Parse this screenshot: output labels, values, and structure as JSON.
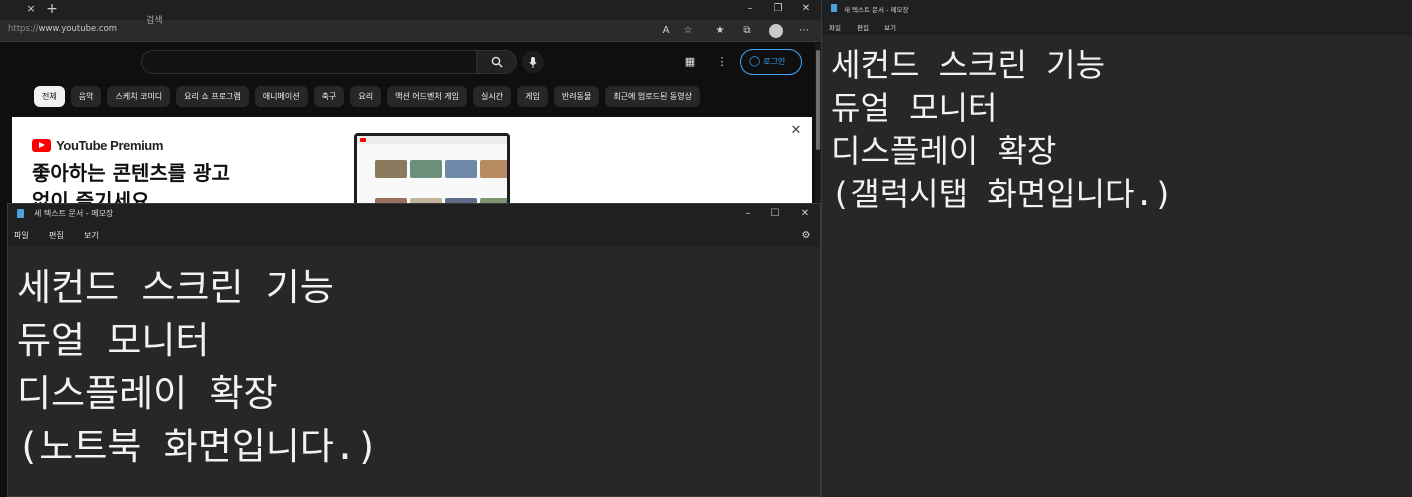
{
  "browser": {
    "url_prefix": "https://",
    "url_host": "www.youtube.com",
    "tab_close_glyph": "×",
    "new_tab_glyph": "+",
    "win_minimize": "–",
    "win_restore": "❐",
    "win_close": "✕"
  },
  "youtube": {
    "search_placeholder": "검색",
    "login_label": "로그인",
    "chips": [
      "전체",
      "음악",
      "스케치 코미디",
      "요리 쇼 프로그램",
      "애니메이션",
      "축구",
      "요리",
      "액션 어드벤처 게임",
      "실시간",
      "게임",
      "반려동물",
      "최근에 업로드된 동영상"
    ],
    "promo": {
      "brand": "YouTube Premium",
      "headline_line1": "좋아하는 콘텐츠를 광고",
      "headline_line2": "없이 즐기세요"
    }
  },
  "notepad_laptop": {
    "title": "세 텍스트 문서 - 메모장",
    "menu": [
      "파일",
      "편집",
      "보기"
    ],
    "lines": [
      "세컨드 스크린 기능",
      "듀얼 모니터",
      "디스플레이 확장",
      "(노트북 화면입니다.)"
    ]
  },
  "notepad_tablet": {
    "title": "새 텍스트 문서 - 메모장",
    "menu": [
      "파일",
      "편집",
      "보기"
    ],
    "lines": [
      "세컨드 스크린 기능",
      "듀얼 모니터",
      "디스플레이 확장",
      "(갤럭시탭 화면입니다.)"
    ]
  },
  "colors": {
    "youtube_red": "#ff0000",
    "accent_blue": "#3ea6ff",
    "notepad_bg": "#272727"
  }
}
